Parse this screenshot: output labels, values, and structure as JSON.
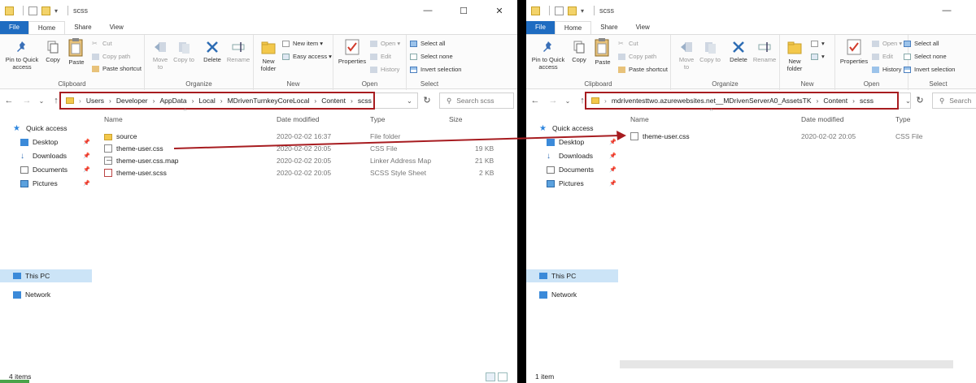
{
  "left": {
    "title": "scss",
    "tabs": [
      "File",
      "Home",
      "Share",
      "View"
    ],
    "ribbon": {
      "clipboard": {
        "pin": "Pin to Quick access",
        "copy": "Copy",
        "paste": "Paste",
        "cut": "Cut",
        "copy_path": "Copy path",
        "paste_shortcut": "Paste shortcut",
        "label": "Clipboard"
      },
      "organize": {
        "move": "Move to",
        "copy": "Copy to",
        "delete": "Delete",
        "rename": "Rename",
        "label": "Organize"
      },
      "new": {
        "new_folder": "New folder",
        "new_item": "New item",
        "easy_access": "Easy access",
        "label": "New"
      },
      "open": {
        "properties": "Properties",
        "open": "Open",
        "edit": "Edit",
        "history": "History",
        "label": "Open"
      },
      "select": {
        "select_all": "Select all",
        "select_none": "Select none",
        "invert": "Invert selection",
        "label": "Select"
      }
    },
    "path": [
      "Users",
      "Developer",
      "AppData",
      "Local",
      "MDrivenTurnkeyCoreLocal",
      "Content",
      "scss"
    ],
    "search_placeholder": "Search scss",
    "sidebar": {
      "quick_access": "Quick access",
      "items": [
        "Desktop",
        "Downloads",
        "Documents",
        "Pictures"
      ],
      "this_pc": "This PC",
      "network": "Network"
    },
    "columns": {
      "name": "Name",
      "date": "Date modified",
      "type": "Type",
      "size": "Size"
    },
    "files": [
      {
        "name": "source",
        "date": "2020-02-02 16:37",
        "type": "File folder",
        "size": "",
        "icon": "folder-icon"
      },
      {
        "name": "theme-user.css",
        "date": "2020-02-02 20:05",
        "type": "CSS File",
        "size": "19 KB",
        "icon": "css-file-icon"
      },
      {
        "name": "theme-user.css.map",
        "date": "2020-02-02 20:05",
        "type": "Linker Address Map",
        "size": "21 KB",
        "icon": "map-file-icon"
      },
      {
        "name": "theme-user.scss",
        "date": "2020-02-02 20:05",
        "type": "SCSS Style Sheet",
        "size": "2 KB",
        "icon": "scss-file-icon"
      }
    ],
    "status": "4 items"
  },
  "right": {
    "title": "scss",
    "tabs": [
      "File",
      "Home",
      "Share",
      "View"
    ],
    "ribbon": {
      "clipboard": {
        "pin": "Pin to Quick access",
        "copy": "Copy",
        "paste": "Paste",
        "cut": "Cut",
        "copy_path": "Copy path",
        "paste_shortcut": "Paste shortcut",
        "label": "Clipboard"
      },
      "organize": {
        "move": "Move to",
        "copy": "Copy to",
        "delete": "Delete",
        "rename": "Rename",
        "label": "Organize"
      },
      "new": {
        "new_folder": "New folder",
        "label": "New"
      },
      "open": {
        "properties": "Properties",
        "open": "Open",
        "edit": "Edit",
        "history": "History",
        "label": "Open"
      },
      "select": {
        "select_all": "Select all",
        "select_none": "Select none",
        "invert": "Invert selection",
        "label": "Select"
      }
    },
    "path": [
      "mdriventesttwo.azurewebsites.net__MDrivenServerA0_AssetsTK",
      "Content",
      "scss"
    ],
    "search_placeholder": "Search",
    "sidebar": {
      "quick_access": "Quick access",
      "items": [
        "Desktop",
        "Downloads",
        "Documents",
        "Pictures"
      ],
      "this_pc": "This PC",
      "network": "Network"
    },
    "columns": {
      "name": "Name",
      "date": "Date modified",
      "type": "Type"
    },
    "files": [
      {
        "name": "theme-user.css",
        "date": "2020-02-02 20:05",
        "type": "CSS File",
        "icon": "css-file-icon"
      }
    ],
    "status": "1 item"
  },
  "colors": {
    "highlight": "#a71c20",
    "arrow": "#a71c20",
    "file_tab": "#1f6cc1",
    "selection": "#cce4f7"
  }
}
